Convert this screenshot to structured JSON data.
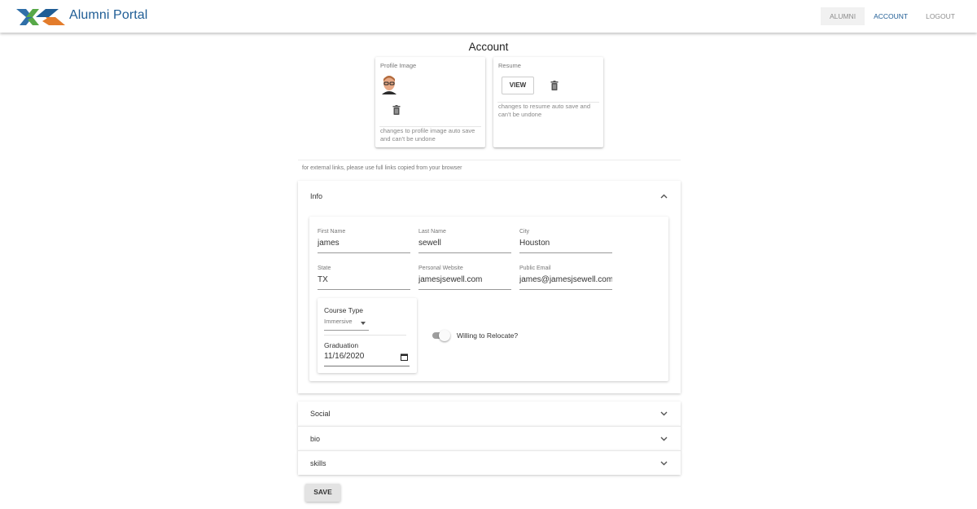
{
  "app": {
    "title": "Alumni Portal",
    "brand_color": "#1f5d95",
    "logo_colors": [
      "#2f6fa8",
      "#57a848",
      "#e37c2b",
      "#1f5d95"
    ]
  },
  "nav": {
    "alumni": "ALUMNI",
    "account": "ACCOUNT",
    "logout": "LOGOUT"
  },
  "page": {
    "title": "Account"
  },
  "profile_card": {
    "label": "Profile Image",
    "avatar_icon": "avatar-photo",
    "delete_icon": "trash-icon",
    "note": "changes to profile image auto save and can't be undone"
  },
  "resume_card": {
    "label": "Resume",
    "view_label": "VIEW",
    "delete_icon": "trash-icon",
    "note": "changes to resume auto save and can't be undone"
  },
  "external_note": "for external links, please use full links copied from your browser",
  "info": {
    "header": "Info",
    "expanded": true,
    "fields": {
      "first_name": {
        "label": "First Name",
        "value": "james"
      },
      "last_name": {
        "label": "Last Name",
        "value": "sewell"
      },
      "city": {
        "label": "City",
        "value": "Houston"
      },
      "state": {
        "label": "State",
        "value": "TX"
      },
      "website": {
        "label": "Personal Website",
        "value": "jamesjsewell.com"
      },
      "email": {
        "label": "Public Email",
        "value": "james@jamesjsewell.com"
      }
    },
    "course_type": {
      "label": "Course Type",
      "value": "Immersive"
    },
    "graduation": {
      "label": "Graduation",
      "value": "11/16/2020"
    },
    "relocate": {
      "label": "Willing to Relocate?",
      "on": false
    }
  },
  "sections": {
    "social": "Social",
    "bio": "bio",
    "skills": "skills"
  },
  "save_label": "SAVE"
}
